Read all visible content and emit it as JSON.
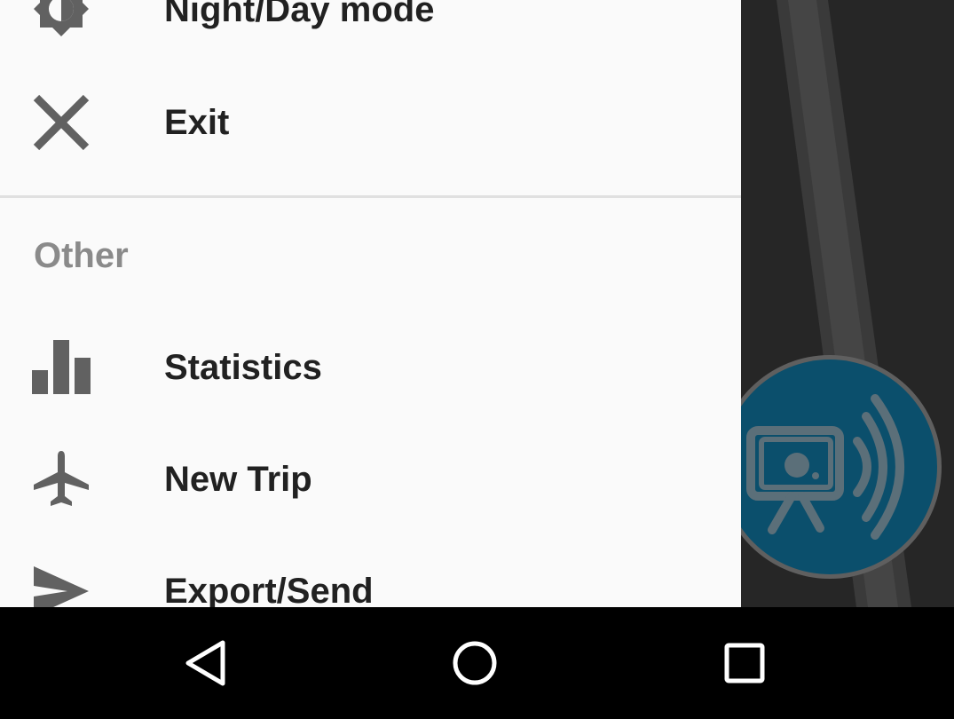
{
  "drawer": {
    "items_top": [
      {
        "label": "Night/Day mode",
        "icon": "brightness-icon"
      },
      {
        "label": "Exit",
        "icon": "close-icon"
      }
    ],
    "section_other": {
      "header": "Other",
      "items": [
        {
          "label": "Statistics",
          "icon": "bar-chart-icon"
        },
        {
          "label": "New Trip",
          "icon": "airplane-icon"
        },
        {
          "label": "Export/Send",
          "icon": "send-icon"
        }
      ]
    }
  },
  "map": {
    "fab_icon": "camera-broadcast-icon",
    "fab_color": "#0b4f6c",
    "fab_ring_color": "#616161"
  },
  "navbar": {
    "buttons": [
      "back-icon",
      "home-icon",
      "recents-icon"
    ]
  },
  "colors": {
    "drawer_bg": "#fafafa",
    "text_primary": "#212121",
    "text_secondary": "#8a8a8a",
    "icon": "#616161",
    "map_bg": "#262626"
  }
}
